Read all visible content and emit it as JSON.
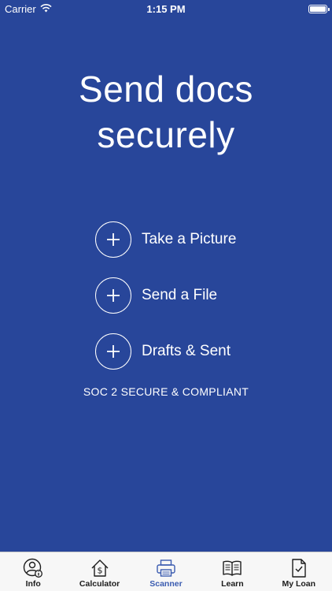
{
  "status_bar": {
    "carrier": "Carrier",
    "time": "1:15 PM"
  },
  "main": {
    "heading_line1": "Send docs",
    "heading_line2": "securely",
    "actions": [
      {
        "label": "Take a Picture"
      },
      {
        "label": "Send a File"
      },
      {
        "label": "Drafts & Sent"
      }
    ],
    "compliance_text": "SOC 2 SECURE & COMPLIANT"
  },
  "tab_bar": {
    "active": "Scanner",
    "tabs": [
      {
        "label": "Info",
        "icon": "person-info-icon"
      },
      {
        "label": "Calculator",
        "icon": "house-dollar-icon"
      },
      {
        "label": "Scanner",
        "icon": "scanner-icon"
      },
      {
        "label": "Learn",
        "icon": "book-icon"
      },
      {
        "label": "My Loan",
        "icon": "document-check-icon"
      }
    ]
  },
  "colors": {
    "background": "#28469a",
    "active_tab": "#3a5bb0",
    "tab_bar": "#f7f7f7"
  }
}
